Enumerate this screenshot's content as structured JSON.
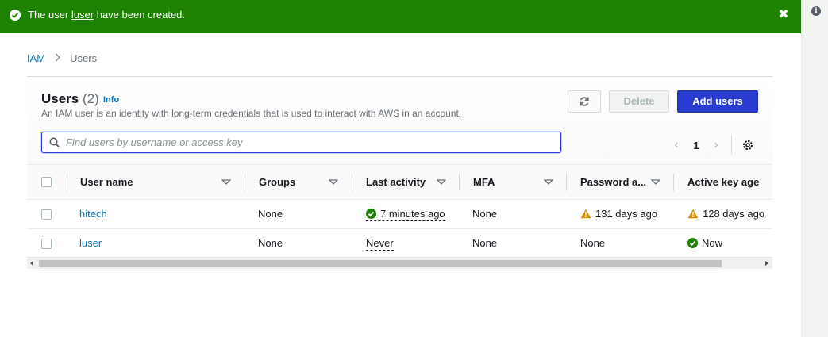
{
  "flash": {
    "message_prefix": "The user ",
    "username": "luser",
    "message_suffix": " have been created.",
    "close": "✖",
    "color": "#1d8102"
  },
  "breadcrumb": {
    "root": "IAM",
    "current": "Users"
  },
  "users_panel": {
    "title": "Users",
    "count": "(2)",
    "info_link": "Info",
    "description": "An IAM user is an identity with long-term credentials that is used to interact with AWS in an account.",
    "delete_label": "Delete",
    "add_label": "Add users",
    "search_placeholder": "Find users by username or access key",
    "current_page": "1"
  },
  "columns": [
    "User name",
    "Groups",
    "Last activity",
    "MFA",
    "Password a...",
    "Active key age"
  ],
  "rows": [
    {
      "user_name": "hitech",
      "groups": "None",
      "last_activity": "7 minutes ago",
      "last_activity_icon": "success-check-icon",
      "mfa": "None",
      "password_age": "131 days ago",
      "password_icon": "warning-icon",
      "key_age": "128 days ago",
      "key_icon": "warning-icon"
    },
    {
      "user_name": "luser",
      "groups": "None",
      "last_activity": "Never",
      "mfa": "None",
      "password_age": "None",
      "key_age": "Now",
      "key_icon": "success-check-icon"
    }
  ],
  "colors": {
    "primary": "#2a3bd0",
    "link": "#0073bb",
    "success": "#1d8102",
    "warning": "#d68c00"
  }
}
